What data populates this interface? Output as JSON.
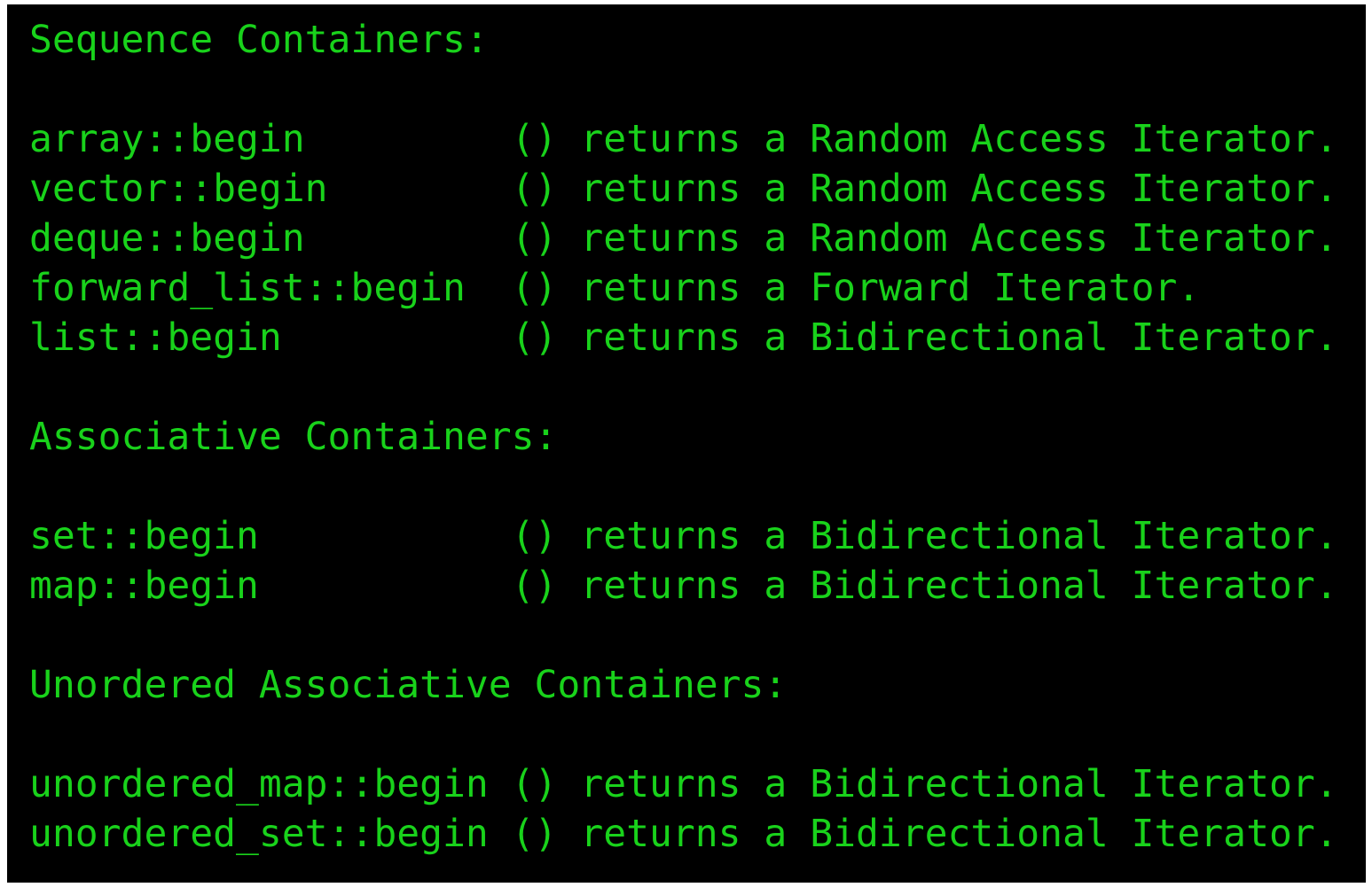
{
  "theme": {
    "background": "#000000",
    "text_color": "#19d21b",
    "frame_color": "#ffffff"
  },
  "sections": [
    {
      "heading": "Sequence Containers:",
      "rows": [
        "array::begin         () returns a Random Access Iterator.",
        "vector::begin        () returns a Random Access Iterator.",
        "deque::begin         () returns a Random Access Iterator.",
        "forward_list::begin  () returns a Forward Iterator.",
        "list::begin          () returns a Bidirectional Iterator."
      ]
    },
    {
      "heading": "Associative Containers:",
      "rows": [
        "set::begin           () returns a Bidirectional Iterator.",
        "map::begin           () returns a Bidirectional Iterator."
      ]
    },
    {
      "heading": "Unordered Associative Containers:",
      "rows": [
        "unordered_map::begin () returns a Bidirectional Iterator.",
        "unordered_set::begin () returns a Bidirectional Iterator."
      ]
    }
  ]
}
